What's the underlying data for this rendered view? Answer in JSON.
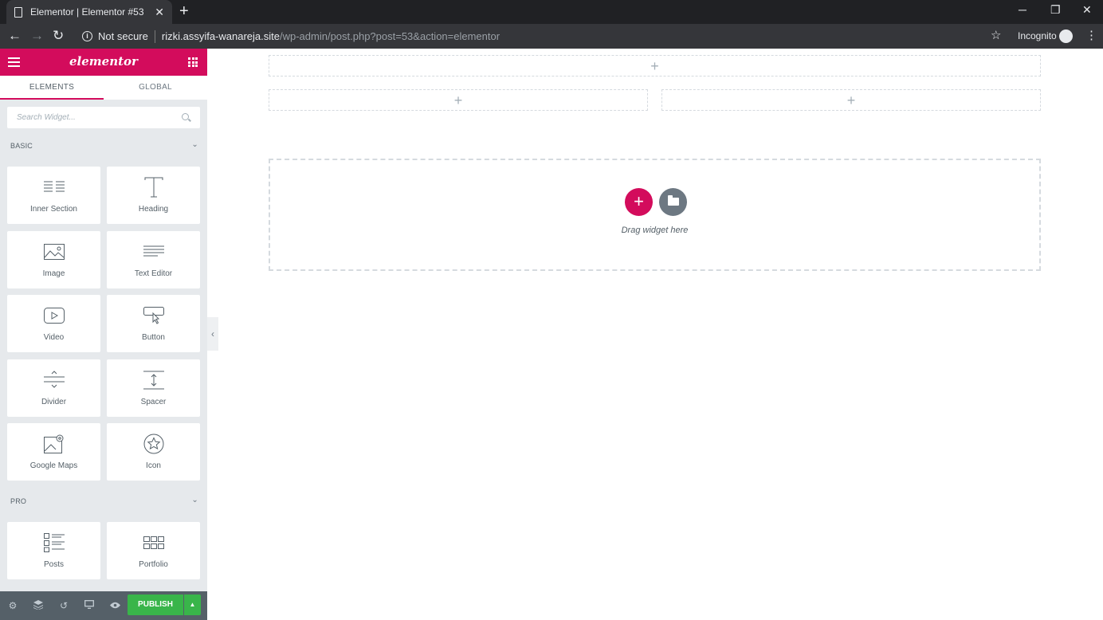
{
  "browser": {
    "tab_title": "Elementor | Elementor #53",
    "tab_close": "✕",
    "new_tab": "+",
    "security_label": "Not secure",
    "url_host": "rizki.assyifa-wanareja.site",
    "url_path": "/wp-admin/post.php?post=53&action=elementor",
    "incognito_label": "Incognito",
    "back": "←",
    "forward": "→",
    "reload": "↻",
    "bookmark": "☆",
    "menu": "⋮",
    "minimize": "─",
    "restore": "❐",
    "close": "✕"
  },
  "panel": {
    "logo": "elementor",
    "tabs": [
      "ELEMENTS",
      "GLOBAL"
    ],
    "search_placeholder": "Search Widget...",
    "categories": [
      {
        "label": "BASIC",
        "chevron": "⌄"
      },
      {
        "label": "PRO",
        "chevron": "⌄"
      }
    ],
    "widgets": [
      {
        "label": "Inner Section",
        "icon": "inner-section-icon"
      },
      {
        "label": "Heading",
        "icon": "heading-icon"
      },
      {
        "label": "Image",
        "icon": "image-icon"
      },
      {
        "label": "Text Editor",
        "icon": "text-editor-icon"
      },
      {
        "label": "Video",
        "icon": "video-icon"
      },
      {
        "label": "Button",
        "icon": "button-icon"
      },
      {
        "label": "Divider",
        "icon": "divider-icon"
      },
      {
        "label": "Spacer",
        "icon": "spacer-icon"
      },
      {
        "label": "Google Maps",
        "icon": "google-maps-icon"
      },
      {
        "label": "Icon",
        "icon": "star-icon"
      },
      {
        "label": "Posts",
        "icon": "posts-icon"
      },
      {
        "label": "Portfolio",
        "icon": "portfolio-icon"
      }
    ],
    "footer": {
      "publish_label": "PUBLISH",
      "arrow": "▲"
    },
    "collapse_arrow": "‹"
  },
  "canvas": {
    "plus": "+",
    "drop_text": "Drag widget here",
    "add_button": "+"
  },
  "colors": {
    "brand": "#d30c5c",
    "publish": "#39b54a",
    "panel_bg": "#e6e9ec"
  }
}
